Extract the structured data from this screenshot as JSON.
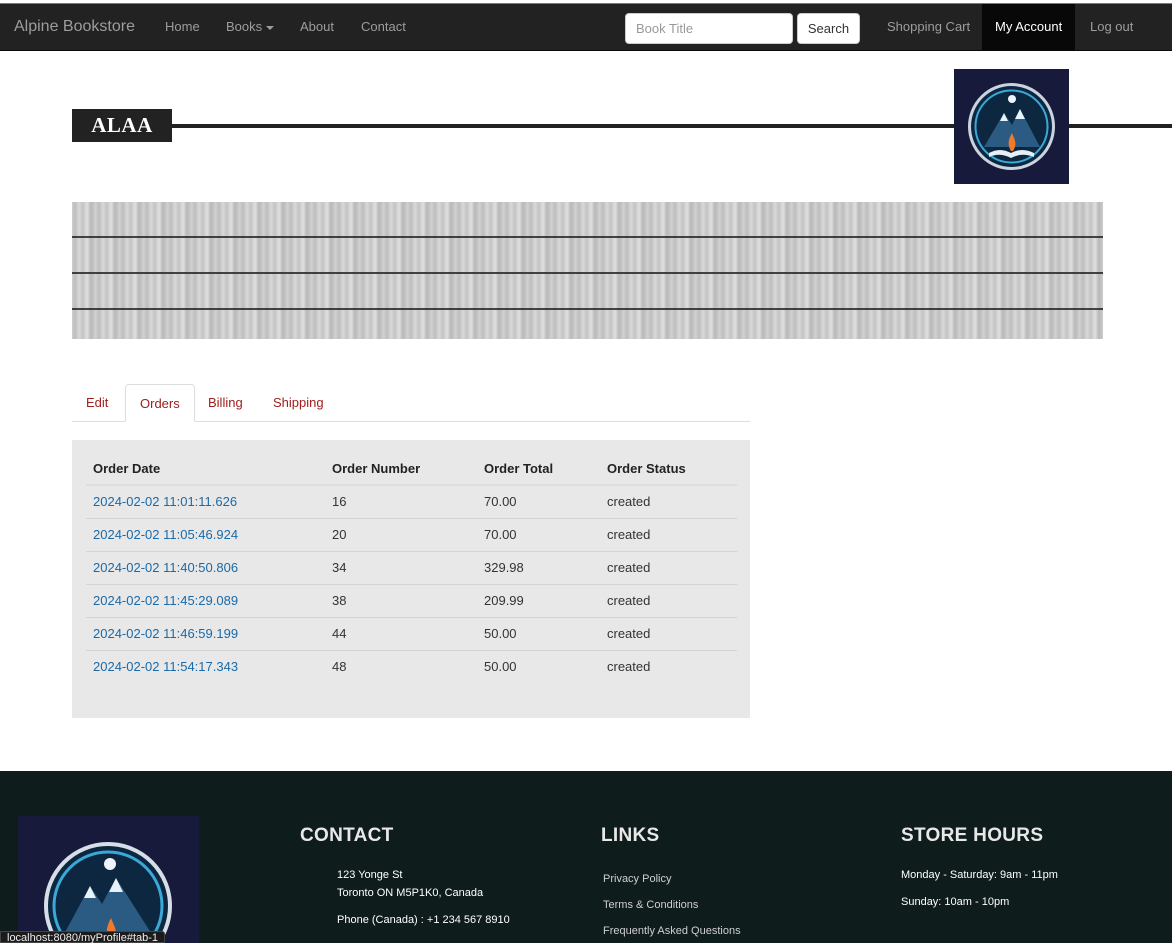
{
  "nav": {
    "brand": "Alpine Bookstore",
    "links": [
      "Home",
      "Books",
      "About",
      "Contact"
    ],
    "search_placeholder": "Book Title",
    "search_button": "Search",
    "shopping_cart": "Shopping Cart",
    "my_account": "My Account",
    "log_out": "Log out"
  },
  "header": {
    "username": "ALAA"
  },
  "tabs": [
    "Edit",
    "Orders",
    "Billing",
    "Shipping"
  ],
  "active_tab": "Orders",
  "orders": {
    "columns": [
      "Order Date",
      "Order Number",
      "Order Total",
      "Order Status"
    ],
    "rows": [
      {
        "date": "2024-02-02 11:01:11.626",
        "number": "16",
        "total": "70.00",
        "status": "created"
      },
      {
        "date": "2024-02-02 11:05:46.924",
        "number": "20",
        "total": "70.00",
        "status": "created"
      },
      {
        "date": "2024-02-02 11:40:50.806",
        "number": "34",
        "total": "329.98",
        "status": "created"
      },
      {
        "date": "2024-02-02 11:45:29.089",
        "number": "38",
        "total": "209.99",
        "status": "created"
      },
      {
        "date": "2024-02-02 11:46:59.199",
        "number": "44",
        "total": "50.00",
        "status": "created"
      },
      {
        "date": "2024-02-02 11:54:17.343",
        "number": "48",
        "total": "50.00",
        "status": "created"
      }
    ]
  },
  "footer": {
    "contact_heading": "CONTACT",
    "address_line1": "123 Yonge St",
    "address_line2": "Toronto ON M5P1K0, Canada",
    "phone": "Phone (Canada) : +1 234 567 8910",
    "links_heading": "LINKS",
    "links": [
      "Privacy Policy",
      "Terms & Conditions",
      "Frequently Asked Questions"
    ],
    "hours_heading": "STORE HOURS",
    "hours": [
      "Monday - Saturday: 9am - 11pm",
      "Sunday: 10am - 10pm"
    ]
  },
  "status_bar_url": "localhost:8080/myProfile#tab-1"
}
